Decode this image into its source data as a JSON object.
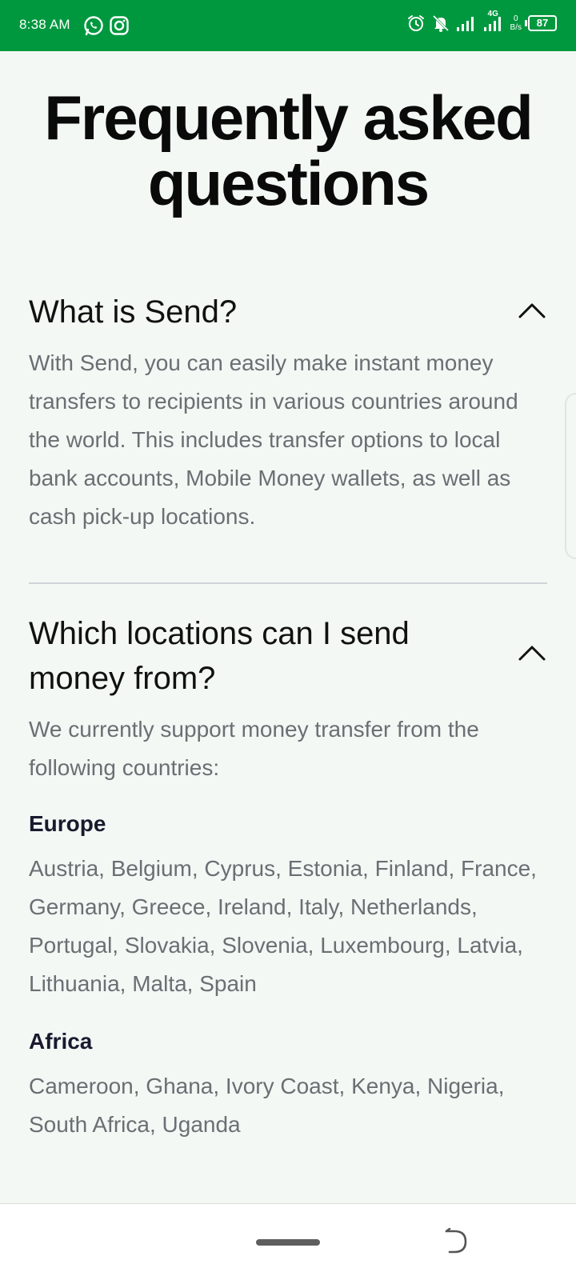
{
  "status_bar": {
    "time": "8:38 AM",
    "left_icons": [
      "whatsapp-icon",
      "instagram-icon"
    ],
    "right_icons": [
      "alarm-icon",
      "mute-bell-icon",
      "signal-icon",
      "signal-4g-icon"
    ],
    "network_type": "4G",
    "net_speed_value": "0",
    "net_speed_unit": "B/s",
    "battery": "87",
    "color": "#00983f"
  },
  "page": {
    "title": "Frequently asked questions"
  },
  "faqs": [
    {
      "question": "What is Send?",
      "answer": "With Send, you can easily make instant money transfers to recipients in various countries around the world. This includes transfer options to local bank accounts, Mobile Money wallets, as well as cash pick-up locations.",
      "expanded_icon": "chevron-up-icon"
    },
    {
      "question": "Which locations can I send money from?",
      "answer": "We currently support money transfer from the following countries:",
      "expanded_icon": "chevron-up-icon",
      "regions": [
        {
          "name": "Europe",
          "countries": "Austria, Belgium, Cyprus, Estonia, Finland, France, Germany, Greece, Ireland, Italy, Netherlands, Portugal, Slovakia, Slovenia, Luxembourg, Latvia, Lithuania, Malta, Spain"
        },
        {
          "name": "Africa",
          "countries": "Cameroon, Ghana, Ivory Coast, Kenya, Nigeria, South Africa, Uganda"
        }
      ]
    }
  ],
  "nav_bar": {
    "icons": [
      "home-pill",
      "back-icon"
    ]
  }
}
